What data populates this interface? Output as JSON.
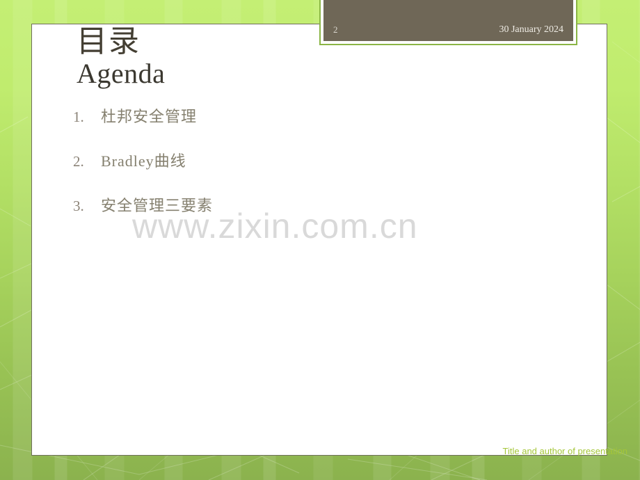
{
  "slide": {
    "header": {
      "slide_number": "2",
      "date": "30 January 2024"
    },
    "title": {
      "chinese": "目录",
      "english": "Agenda"
    },
    "agenda": [
      {
        "number": "1.",
        "text": "杜邦安全管理"
      },
      {
        "number": "2.",
        "text": "Bradley曲线"
      },
      {
        "number": "3.",
        "text": "安全管理三要素"
      }
    ],
    "watermark": "www.zixin.com.cn",
    "footer": "Title and author of presentation",
    "colors": {
      "background_top": "#c4ef74",
      "background_bottom": "#8bb24e",
      "plaque": "#6f6757",
      "plaque_accent": "#8ab545",
      "card": "#ffffff",
      "card_border": "#6f6f5c",
      "title": "#443f33",
      "list_text": "#85806f",
      "footer_text": "#a4c639",
      "watermark": "#d9d9d9"
    }
  }
}
